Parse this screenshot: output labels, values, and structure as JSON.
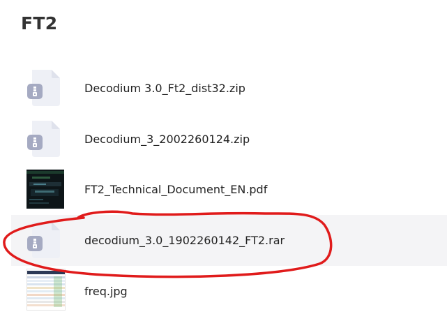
{
  "folder": {
    "title": "FT2"
  },
  "files": [
    {
      "name": "Decodium 3.0_Ft2_dist32.zip",
      "icon": "archive-icon",
      "type": "zip"
    },
    {
      "name": "Decodium_3_2002260124.zip",
      "icon": "archive-icon",
      "type": "zip"
    },
    {
      "name": "FT2_Technical_Document_EN.pdf",
      "icon": "pdf-thumbnail",
      "type": "pdf"
    },
    {
      "name": "decodium_3.0_1902260142_FT2.rar",
      "icon": "archive-icon",
      "type": "rar",
      "selected": true
    },
    {
      "name": "freq.jpg",
      "icon": "image-thumbnail",
      "type": "jpg"
    }
  ],
  "colors": {
    "selected_row_bg": "#f4f4f6",
    "annotation_stroke": "#e01b1b",
    "archive_icon_page": "#eef0f6",
    "archive_icon_badge": "#a5aac2"
  }
}
